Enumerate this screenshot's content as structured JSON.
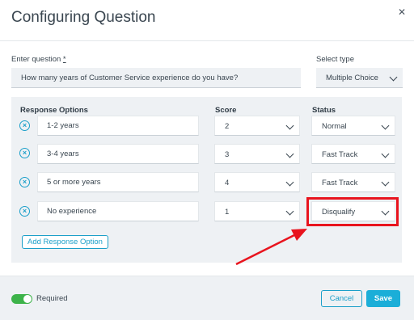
{
  "modal": {
    "title": "Configuring Question",
    "close_icon": "close-icon"
  },
  "question": {
    "label": "Enter question",
    "required_mark": "*",
    "value": "How many years of Customer Service experience do you have?"
  },
  "select_type": {
    "label": "Select type",
    "value": "Multiple Choice"
  },
  "columns": {
    "response_options": "Response Options",
    "score": "Score",
    "status": "Status"
  },
  "responses": [
    {
      "option": "1-2 years",
      "score": "2",
      "status": "Normal"
    },
    {
      "option": "3-4 years",
      "score": "3",
      "status": "Fast Track"
    },
    {
      "option": "5 or more years",
      "score": "4",
      "status": "Fast Track"
    },
    {
      "option": "No experience",
      "score": "1",
      "status": "Disqualify"
    }
  ],
  "add_response_option": "Add Response Option",
  "footer": {
    "required_label": "Required",
    "required_on": true,
    "cancel_label": "Cancel",
    "save_label": "Save"
  },
  "colors": {
    "accent": "#1b9fc9",
    "save": "#1baed8",
    "toggle_on": "#3db34a",
    "highlight": "#e8141e"
  }
}
